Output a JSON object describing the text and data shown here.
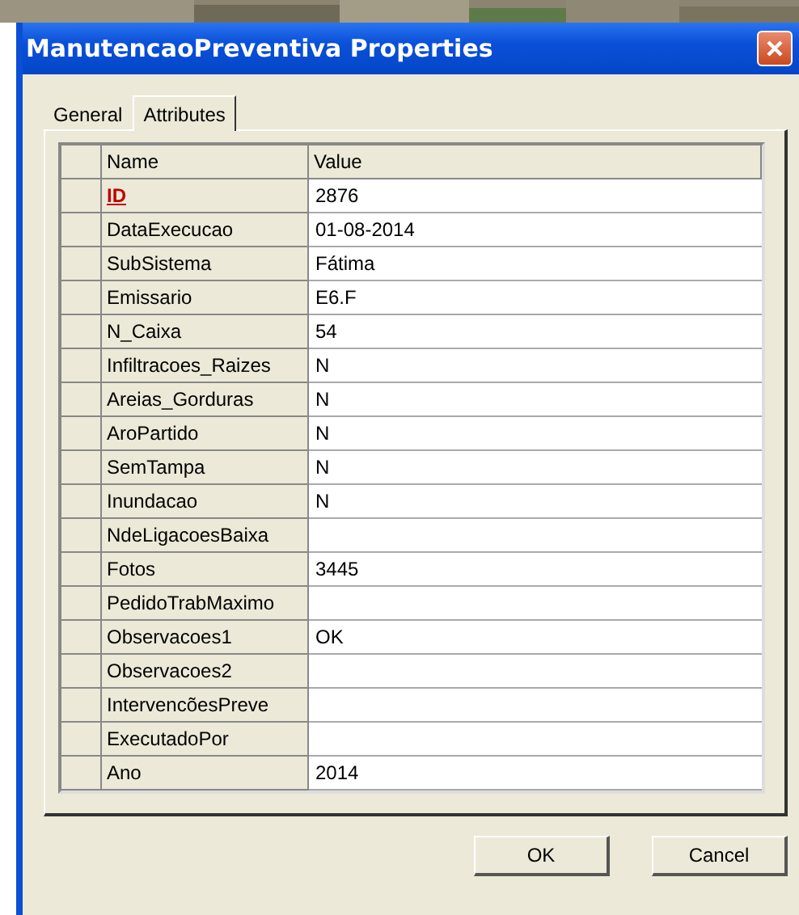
{
  "window": {
    "title": "ManutencaoPreventiva Properties"
  },
  "tabs": [
    {
      "label": "General",
      "selected": false
    },
    {
      "label": "Attributes",
      "selected": true
    }
  ],
  "table": {
    "columns": [
      "Name",
      "Value"
    ],
    "rows": [
      {
        "name": "ID",
        "value": "2876",
        "kind": "key"
      },
      {
        "name": "DataExecucao",
        "value": "01-08-2014",
        "kind": "field"
      },
      {
        "name": "SubSistema",
        "value": "Fátima",
        "kind": "field"
      },
      {
        "name": "Emissario",
        "value": "E6.F",
        "kind": "field"
      },
      {
        "name": "N_Caixa",
        "value": "54",
        "kind": "field"
      },
      {
        "name": "Infiltracoes_Raizes",
        "value": "N",
        "kind": "field"
      },
      {
        "name": "Areias_Gorduras",
        "value": "N",
        "kind": "field"
      },
      {
        "name": "AroPartido",
        "value": "N",
        "kind": "field"
      },
      {
        "name": "SemTampa",
        "value": "N",
        "kind": "field"
      },
      {
        "name": "Inundacao",
        "value": "N",
        "kind": "field"
      },
      {
        "name": "NdeLigacoesBaixa",
        "value": "",
        "kind": "field"
      },
      {
        "name": "Fotos",
        "value": "3445",
        "kind": "field"
      },
      {
        "name": "PedidoTrabMaximo",
        "value": "",
        "kind": "field"
      },
      {
        "name": "Observacoes1",
        "value": "OK",
        "kind": "field"
      },
      {
        "name": "Observacoes2",
        "value": "",
        "kind": "field"
      },
      {
        "name": "IntervencõesPreve",
        "value": "",
        "kind": "field"
      },
      {
        "name": "ExecutadoPor",
        "value": "",
        "kind": "field"
      },
      {
        "name": "Ano",
        "value": "2014",
        "kind": "field"
      }
    ]
  },
  "buttons": [
    "OK",
    "Cancel"
  ]
}
